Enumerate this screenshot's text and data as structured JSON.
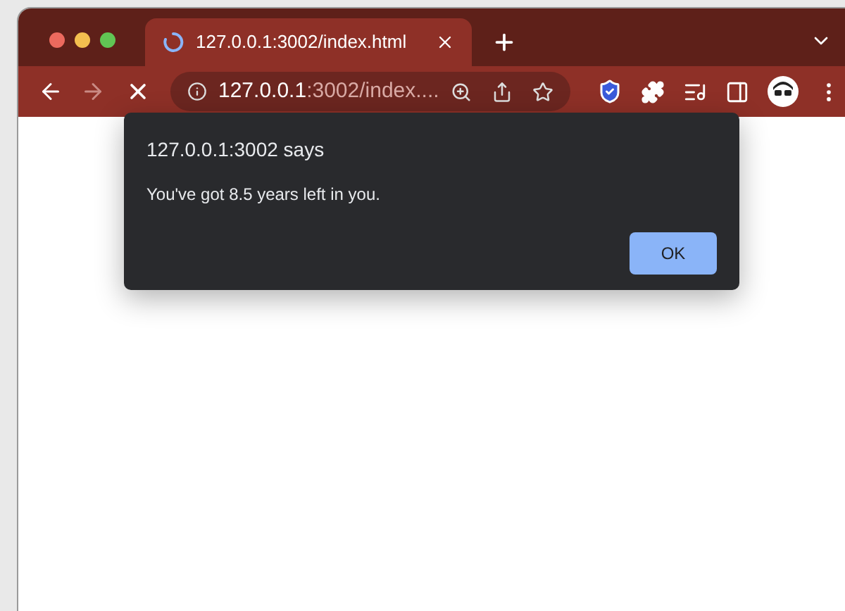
{
  "tab": {
    "title": "127.0.0.1:3002/index.html",
    "selected": true
  },
  "toolbar": {
    "forward_disabled": true
  },
  "address": {
    "host": "127.0.0.1",
    "rest": ":3002/index...."
  },
  "dialog": {
    "title": "127.0.0.1:3002 says",
    "message": "You've got 8.5 years left in you.",
    "button": "OK"
  }
}
